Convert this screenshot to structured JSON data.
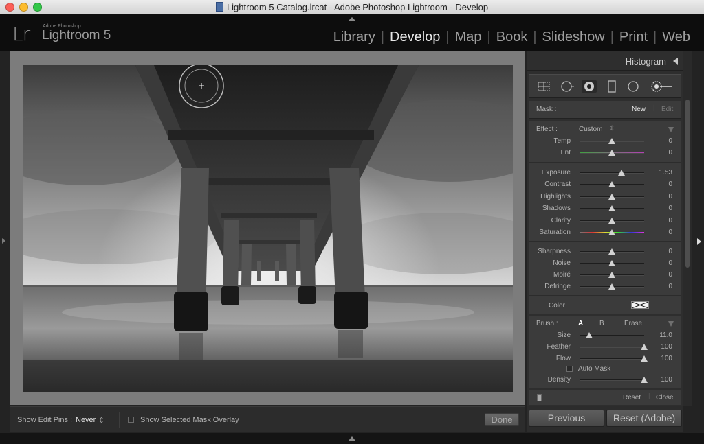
{
  "window": {
    "title": "Lightroom 5 Catalog.lrcat - Adobe Photoshop Lightroom - Develop"
  },
  "branding": {
    "logo": "Lr",
    "sub": "Adobe Photoshop",
    "name": "Lightroom 5"
  },
  "modules": [
    {
      "label": "Library",
      "active": false
    },
    {
      "label": "Develop",
      "active": true
    },
    {
      "label": "Map",
      "active": false
    },
    {
      "label": "Book",
      "active": false
    },
    {
      "label": "Slideshow",
      "active": false
    },
    {
      "label": "Print",
      "active": false
    },
    {
      "label": "Web",
      "active": false
    }
  ],
  "panel": {
    "histogram_label": "Histogram",
    "mask": {
      "label": "Mask :",
      "new": "New",
      "edit": "Edit"
    },
    "effect": {
      "label": "Effect :",
      "value": "Custom"
    },
    "sliders_group1": [
      {
        "label": "Temp",
        "value": "0",
        "pos": 0.5,
        "track": "temp"
      },
      {
        "label": "Tint",
        "value": "0",
        "pos": 0.5,
        "track": "tint"
      }
    ],
    "sliders_group2": [
      {
        "label": "Exposure",
        "value": "1.53",
        "pos": 0.65
      },
      {
        "label": "Contrast",
        "value": "0",
        "pos": 0.5
      },
      {
        "label": "Highlights",
        "value": "0",
        "pos": 0.5
      },
      {
        "label": "Shadows",
        "value": "0",
        "pos": 0.5
      },
      {
        "label": "Clarity",
        "value": "0",
        "pos": 0.5
      },
      {
        "label": "Saturation",
        "value": "0",
        "pos": 0.5,
        "track": "sat"
      }
    ],
    "sliders_group3": [
      {
        "label": "Sharpness",
        "value": "0",
        "pos": 0.5
      },
      {
        "label": "Noise",
        "value": "0",
        "pos": 0.5
      },
      {
        "label": "Moiré",
        "value": "0",
        "pos": 0.5
      },
      {
        "label": "Defringe",
        "value": "0",
        "pos": 0.5
      }
    ],
    "color_label": "Color",
    "brush": {
      "label": "Brush :",
      "a": "A",
      "b": "B",
      "erase": "Erase",
      "sliders": [
        {
          "label": "Size",
          "value": "11.0",
          "pos": 0.15
        },
        {
          "label": "Feather",
          "value": "100",
          "pos": 1.0
        },
        {
          "label": "Flow",
          "value": "100",
          "pos": 1.0
        }
      ],
      "auto_mask": "Auto Mask",
      "density": {
        "label": "Density",
        "value": "100",
        "pos": 1.0
      }
    },
    "footer": {
      "reset": "Reset",
      "close": "Close"
    }
  },
  "toolbar": {
    "show_edit_pins_label": "Show Edit Pins :",
    "show_edit_pins_value": "Never",
    "show_mask_overlay": "Show Selected Mask Overlay",
    "done": "Done"
  },
  "bottom_buttons": {
    "previous": "Previous",
    "reset": "Reset (Adobe)"
  }
}
